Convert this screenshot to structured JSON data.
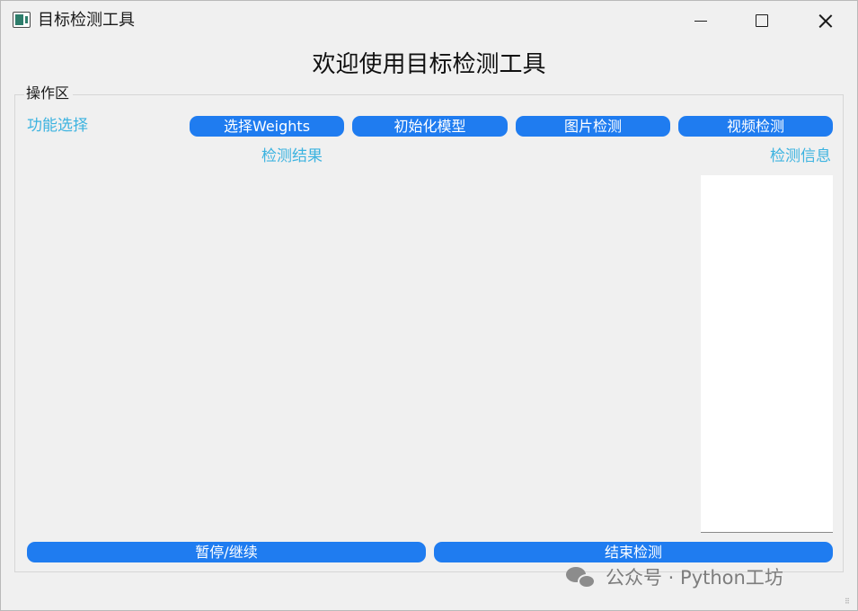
{
  "window": {
    "title": "目标检测工具",
    "icons": {
      "app": "app-window-icon",
      "minimize": "minimize-icon",
      "maximize": "maximize-icon",
      "close": "close-icon"
    }
  },
  "header": {
    "title": "欢迎使用目标检测工具"
  },
  "group": {
    "label": "操作区"
  },
  "labels": {
    "function_select": "功能选择",
    "detection_result": "检测结果",
    "detection_info": "检测信息"
  },
  "buttons": {
    "select_weights": "选择Weights",
    "init_model": "初始化模型",
    "image_detect": "图片检测",
    "video_detect": "视频检测",
    "pause_resume": "暂停/继续",
    "stop_detect": "结束检测"
  },
  "info_box": {
    "content": ""
  },
  "watermark": {
    "text": "公众号 · Python工坊",
    "icon": "wechat-icon"
  },
  "colors": {
    "accent": "#1f7cf0",
    "label_cyan": "#3cb3e0",
    "background": "#f0f0f0"
  }
}
